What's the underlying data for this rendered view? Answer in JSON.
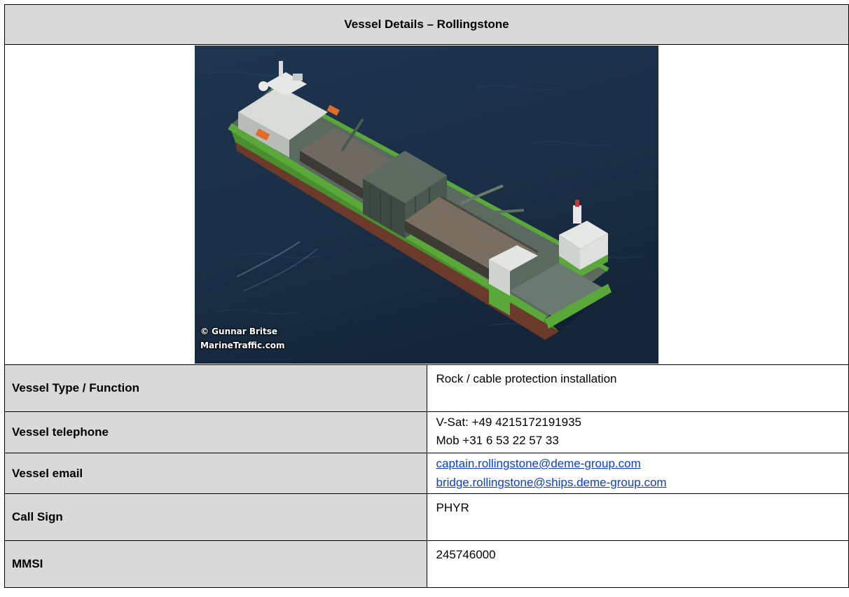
{
  "document": {
    "title": "Vessel Details – Rollingstone",
    "photo": {
      "credit_line1": "© Gunnar Britse",
      "credit_line2": "MarineTraffic.com"
    },
    "rows": {
      "type": {
        "label": "Vessel Type / Function",
        "value": "Rock / cable protection installation"
      },
      "telephone": {
        "label": "Vessel telephone",
        "line1": "V-Sat: +49 4215172191935",
        "line2": "Mob +31 6 53 22 57 33"
      },
      "email": {
        "label": "Vessel email",
        "line1": "captain.rollingstone@deme-group.com",
        "line2": "bridge.rollingstone@ships.deme-group.com"
      },
      "callsign": {
        "label": "Call Sign",
        "value": "PHYR"
      },
      "mmsi": {
        "label": "MMSI",
        "value": "245746000"
      }
    },
    "colors": {
      "header_bg": "#d9d9d9",
      "link": "#0b3fcf",
      "sea": "#1a2e45",
      "hull_green": "#5aa83a"
    }
  }
}
